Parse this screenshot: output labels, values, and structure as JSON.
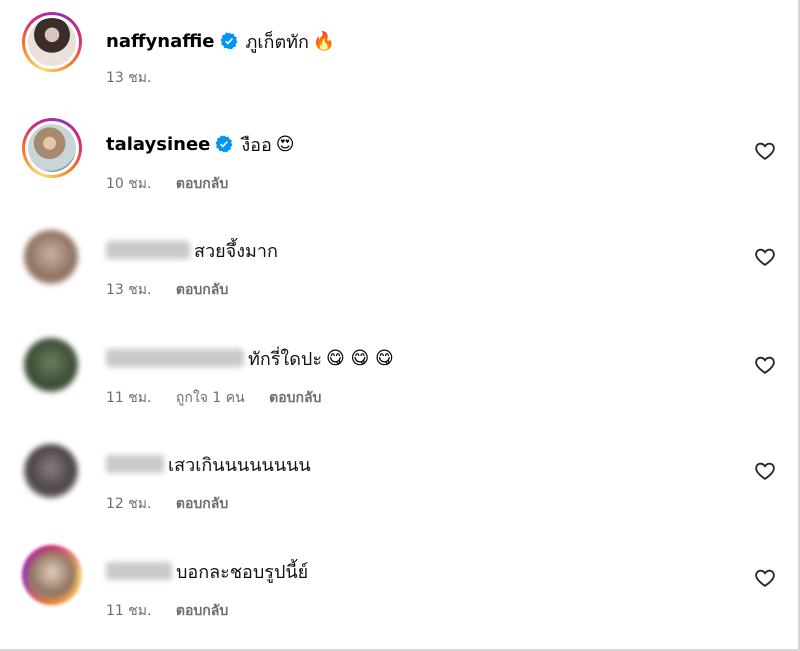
{
  "comments": [
    {
      "username": "naffynaffie",
      "verified": true,
      "text": "ภูเก็ตทัก",
      "emoji": "🔥",
      "time": "13 ชม."
    },
    {
      "username": "talaysinee",
      "verified": true,
      "text": "งืออ",
      "emoji": "😍",
      "time": "10 ชม.",
      "reply": "ตอบกลับ",
      "like_icon": "heart-outline-icon"
    },
    {
      "username_hidden": true,
      "text": "สวยจึ้งมาก",
      "time": "13 ชม.",
      "reply": "ตอบกลับ",
      "like_icon": "heart-outline-icon"
    },
    {
      "username_hidden": true,
      "text": "ทักรี่ใดปะ",
      "emoji": "😋 😋 😋",
      "time": "11 ชม.",
      "likes": "ถูกใจ 1 คน",
      "reply": "ตอบกลับ",
      "like_icon": "heart-outline-icon"
    },
    {
      "username_hidden": true,
      "text": "เสวเกินนนนนนนน",
      "time": "12 ชม.",
      "reply": "ตอบกลับ",
      "like_icon": "heart-outline-icon"
    },
    {
      "username_hidden": true,
      "text": "บอกละชอบรูปนี้ย์",
      "time": "11 ชม.",
      "reply": "ตอบกลับ",
      "like_icon": "heart-outline-icon"
    }
  ],
  "colors": {
    "verified": "#0095f6",
    "meta": "#6e6e6e",
    "story_ring": "#d62976"
  }
}
